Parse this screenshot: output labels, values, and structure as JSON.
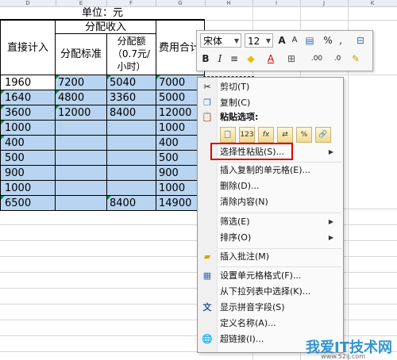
{
  "column_headers": [
    "D",
    "E",
    "F",
    "G",
    "H",
    "I",
    "J",
    "K"
  ],
  "table": {
    "unit_label": "单位：元",
    "group_header": "分配收入",
    "col_direct": "直接计入",
    "col_standard": "分配标准",
    "col_amount": "分配额（0.7元/小时）",
    "col_amount_lines": [
      "分配额",
      "（0.7元/",
      "小时）"
    ],
    "col_cost": "费用合计",
    "rows": [
      [
        "1960",
        "7200",
        "5040",
        "7000"
      ],
      [
        "1640",
        "4800",
        "3360",
        "5000"
      ],
      [
        "3600",
        "12000",
        "8400",
        "12000"
      ],
      [
        "1000",
        "",
        "",
        "1000"
      ],
      [
        "400",
        "",
        "",
        "400"
      ],
      [
        "500",
        "",
        "",
        "500"
      ],
      [
        "900",
        "",
        "",
        "900"
      ],
      [
        "1000",
        "",
        "",
        "1000"
      ],
      [
        "6500",
        "",
        "8400",
        "14900"
      ]
    ]
  },
  "mini_toolbar": {
    "font_name": "宋体",
    "font_size": "12",
    "grow": "A",
    "shrink": "A",
    "format_painter": "",
    "percent": "%",
    "comma": ",",
    "bold": "B",
    "italic": "I",
    "align": "≡",
    "fill": "◆",
    "font_color": "A",
    "border": "⊞",
    "inc_dec": ".00",
    "dec_dec": ".0"
  },
  "context_menu": {
    "items": [
      {
        "label": "剪切(T)",
        "icon": "scissors-icon"
      },
      {
        "label": "复制(C)",
        "icon": "copy-icon"
      },
      {
        "label": "粘贴选项:",
        "icon": "clipboard-icon"
      },
      {
        "label": "选择性粘贴(S)...",
        "icon": ""
      },
      {
        "label": "插入复制的单元格(E)...",
        "icon": ""
      },
      {
        "label": "删除(D)...",
        "icon": ""
      },
      {
        "label": "清除内容(N)",
        "icon": ""
      },
      {
        "label": "筛选(E)",
        "icon": ""
      },
      {
        "label": "排序(O)",
        "icon": ""
      },
      {
        "label": "插入批注(M)",
        "icon": "comment-icon"
      },
      {
        "label": "设置单元格格式(F)...",
        "icon": "format-cells-icon"
      },
      {
        "label": "从下拉列表中选择(K)...",
        "icon": ""
      },
      {
        "label": "显示拼音字段(S)",
        "icon": "phonetic-icon"
      },
      {
        "label": "定义名称(A)...",
        "icon": ""
      },
      {
        "label": "超链接(I)...",
        "icon": "hyperlink-icon"
      }
    ],
    "paste_options": [
      "📋",
      "123",
      "fx",
      "⇄",
      "%",
      "🔗"
    ]
  },
  "watermark": {
    "main": "我爱IT技术网",
    "sub": "www.52ij.com"
  }
}
